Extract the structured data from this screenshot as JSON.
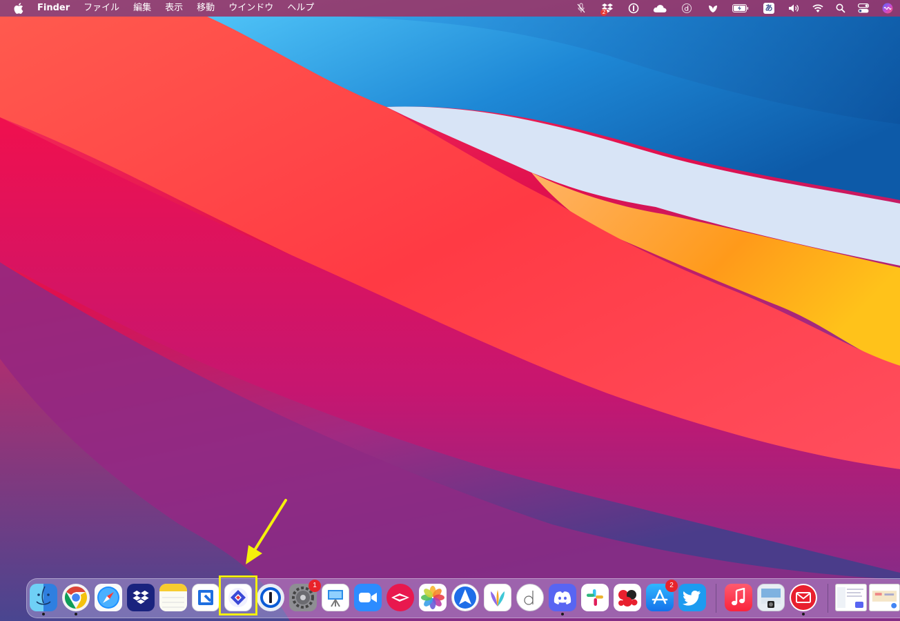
{
  "menubar": {
    "app_name": "Finder",
    "menus": [
      "ファイル",
      "編集",
      "表示",
      "移動",
      "ウインドウ",
      "ヘルプ"
    ],
    "status": {
      "dropbox_badge": "2",
      "input_method": "あ",
      "icons": [
        "mic-off-icon",
        "dropbox-icon",
        "1password-icon",
        "cloud-icon",
        "d-icon",
        "leaf-icon",
        "battery-icon",
        "input-method-icon",
        "volume-icon",
        "wifi-icon",
        "spotlight-icon",
        "control-center-icon",
        "siri-icon"
      ]
    }
  },
  "dock": {
    "apps": [
      {
        "name": "Finder",
        "icon": "finder-icon",
        "running": true
      },
      {
        "name": "Google Chrome",
        "icon": "chrome-icon",
        "running": true
      },
      {
        "name": "Safari",
        "icon": "safari-icon",
        "running": false
      },
      {
        "name": "Dropbox",
        "icon": "dropbox-icon",
        "running": false
      },
      {
        "name": "Notes",
        "icon": "notes-icon",
        "running": false
      },
      {
        "name": "GoodLinks",
        "icon": "link-icon",
        "running": false
      },
      {
        "name": "Screens",
        "icon": "diamond-icon",
        "running": false,
        "highlighted": true
      },
      {
        "name": "1Password",
        "icon": "1password-icon",
        "running": false
      },
      {
        "name": "System Preferences",
        "icon": "gear-icon",
        "running": false,
        "badge": "1"
      },
      {
        "name": "Keynote",
        "icon": "keynote-icon",
        "running": false
      },
      {
        "name": "Zoom",
        "icon": "zoom-icon",
        "running": false
      },
      {
        "name": "Airmail",
        "icon": "airmail-icon",
        "running": false
      },
      {
        "name": "Photos",
        "icon": "photos-icon",
        "running": false
      },
      {
        "name": "Spark",
        "icon": "spark-icon",
        "running": false
      },
      {
        "name": "MindNode",
        "icon": "mindnode-icon",
        "running": false
      },
      {
        "name": "Day One",
        "icon": "d-icon",
        "running": false
      },
      {
        "name": "Discord",
        "icon": "discord-icon",
        "running": true
      },
      {
        "name": "Slack",
        "icon": "slack-icon",
        "running": false
      },
      {
        "name": "Scapple",
        "icon": "dots-icon",
        "running": false
      },
      {
        "name": "App Store",
        "icon": "appstore-icon",
        "running": false,
        "badge": "2"
      },
      {
        "name": "Twitter",
        "icon": "twitter-icon",
        "running": false
      },
      {
        "name": "Music",
        "icon": "music-icon",
        "running": false
      },
      {
        "name": "Preview",
        "icon": "preview-icon",
        "running": false
      },
      {
        "name": "Mail",
        "icon": "mail-icon",
        "running": true
      }
    ]
  }
}
